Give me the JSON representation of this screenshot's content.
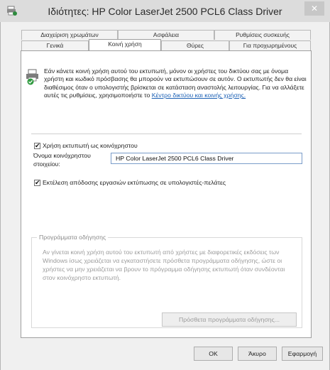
{
  "window": {
    "title": "Ιδιότητες: HP Color LaserJet 2500 PCL6 Class Driver",
    "close_glyph": "✕"
  },
  "tabs": {
    "row1": [
      "Διαχείριση χρωμάτων",
      "Ασφάλεια",
      "Ρυθμίσεις συσκευής"
    ],
    "row2": [
      "Γενικά",
      "Κοινή χρήση",
      "Θύρες",
      "Για προχωρημένους"
    ],
    "active": "Κοινή χρήση"
  },
  "sharing": {
    "intro_text": "Εάν κάνετε κοινή χρήση αυτού του εκτυπωτή, μόνον οι χρήστες του δικτύου σας με όνομα χρήστη και κωδικό πρόσβασης θα μπορούν να εκτυπώσουν σε αυτόν. Ο εκτυπωτής δεν θα είναι διαθέσιμος όταν ο υπολογιστής βρίσκεται σε κατάσταση αναστολής λειτουργίας. Για να αλλάξετε αυτές τις ρυθμίσεις, χρησιμοποιήστε το",
    "intro_link": "Κέντρο δικτύου και κοινής χρήσης.",
    "share_checkbox_label": "Χρήση εκτυπωτή ως κοινόχρηστου",
    "share_checked": true,
    "share_name_label_1": "Όνομα κοινόχρηστου",
    "share_name_label_2": "στοιχείου:",
    "share_name_value": "HP Color LaserJet 2500 PCL6 Class Driver",
    "render_checkbox_label": "Εκτέλεση απόδοσης εργασιών εκτύπωσης σε υπολογιστές-πελάτες",
    "render_checked": true,
    "check_glyph": "✔"
  },
  "drivers": {
    "group_title": "Προγράμματα οδήγησης",
    "description": "Αν γίνεται κοινή χρήση αυτού του εκτυπωτή από χρήστες με διαφορετικές εκδόσεις των Windows ίσως χρειάζεται να εγκαταστήσετε πρόσθετα προγράμματα οδήγησης, ώστε οι χρήστες να μην χρειάζεται να βρουν το πρόγραμμα οδήγησης εκτυπωτή όταν συνδέονται στον κοινόχρηστο εκτυπωτή.",
    "additional_button": "Πρόσθετα προγράμματα οδήγησης..."
  },
  "buttons": {
    "ok": "OK",
    "cancel": "Άκυρο",
    "apply": "Εφαρμογή"
  },
  "colors": {
    "link": "#1a5fb4",
    "input_border": "#7a9cc9",
    "disabled_text": "#9b9b9b"
  },
  "icons": {
    "app": "printer-icon",
    "sharing": "shared-printer-icon"
  }
}
